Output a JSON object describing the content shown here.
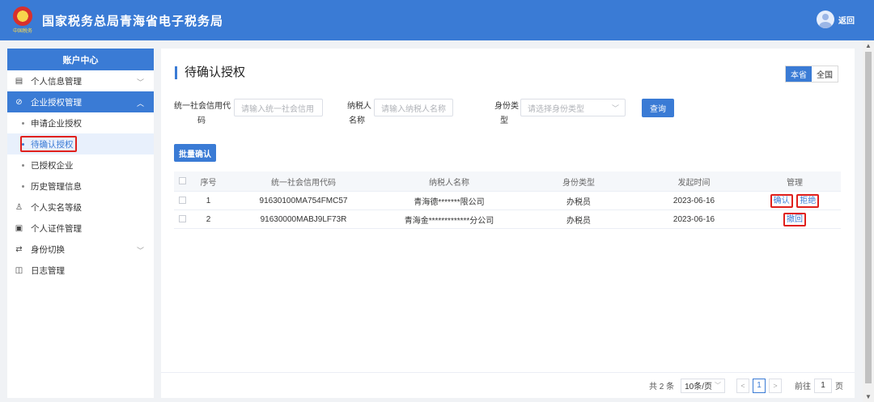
{
  "header": {
    "title": "国家税务总局青海省电子税务局",
    "emblem_text": "中国税务",
    "back_label": "返回"
  },
  "sidebar": {
    "title": "账户中心",
    "items": [
      {
        "label": "个人信息管理",
        "icon": "profile-icon"
      },
      {
        "label": "企业授权管理",
        "icon": "shield-check-icon"
      },
      {
        "label": "个人实名等级",
        "icon": "user-level-icon"
      },
      {
        "label": "个人证件管理",
        "icon": "id-card-icon"
      },
      {
        "label": "身份切换",
        "icon": "switch-identity-icon"
      },
      {
        "label": "日志管理",
        "icon": "log-icon"
      }
    ],
    "sub_items": [
      {
        "label": "申请企业授权"
      },
      {
        "label": "待确认授权"
      },
      {
        "label": "已授权企业"
      },
      {
        "label": "历史管理信息"
      }
    ]
  },
  "main": {
    "title": "待确认授权",
    "scope": {
      "local": "本省",
      "national": "全国"
    },
    "filters": {
      "credit_code_label_1": "统一社会信用代",
      "credit_code_label_2": "码",
      "credit_code_placeholder": "请输入统一社会信用",
      "taxpayer_label_1": "纳税人",
      "taxpayer_label_2": "名称",
      "taxpayer_placeholder": "请输入纳税人名称",
      "identity_label_1": "身份类",
      "identity_label_2": "型",
      "identity_placeholder": "请选择身份类型"
    },
    "query_label": "查询",
    "batch_confirm_label": "批量确认"
  },
  "table": {
    "headers": {
      "no": "序号",
      "code": "统一社会信用代码",
      "name": "纳税人名称",
      "type": "身份类型",
      "time": "发起时间",
      "manage": "管理"
    },
    "rows": [
      {
        "no": "1",
        "code": "91630100MA754FMC57",
        "name": "青海德*******限公司",
        "type": "办税员",
        "time": "2023-06-16",
        "actions": [
          "确认",
          "拒绝"
        ]
      },
      {
        "no": "2",
        "code": "91630000MABJ9LF73R",
        "name": "青海金*************分公司",
        "type": "办税员",
        "time": "2023-06-16",
        "actions": [
          "撤回"
        ]
      }
    ]
  },
  "pagination": {
    "total": "共 2 条",
    "page_size": "10条/页",
    "current_page": "1",
    "goto_label": "前往",
    "goto_value": "1",
    "page_unit": "页"
  }
}
